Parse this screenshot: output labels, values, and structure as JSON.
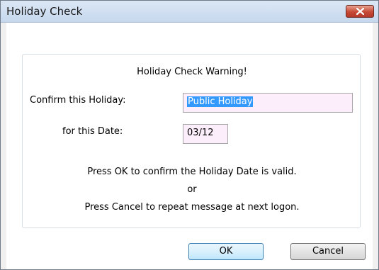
{
  "window": {
    "title": "Holiday Check"
  },
  "dialog": {
    "heading": "Holiday Check Warning!",
    "holiday_label": "Confirm this Holiday:",
    "holiday_value": "Public Holiday",
    "date_label": "for this Date:",
    "date_value": "03/12",
    "message_line1": "Press OK to confirm the Holiday Date is valid.",
    "message_or": "or",
    "message_line2": "Press Cancel to repeat message at next logon."
  },
  "buttons": {
    "ok_label": "OK",
    "cancel_label": "Cancel"
  },
  "icons": {
    "close": "close-icon"
  },
  "colors": {
    "selection": "#3399ff",
    "field_background": "#fdeefb"
  }
}
